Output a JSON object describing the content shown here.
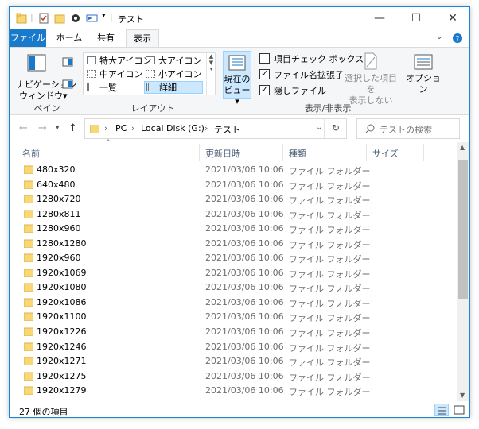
{
  "window": {
    "title": "テスト"
  },
  "tabs": [
    {
      "label": "ファイル"
    },
    {
      "label": "ホーム"
    },
    {
      "label": "共有"
    },
    {
      "label": "表示"
    }
  ],
  "ribbon": {
    "pane": {
      "nav_label": "ナビゲーション",
      "nav_label2": "ウィンドウ▾",
      "group_label": "ペイン"
    },
    "layout": {
      "items": [
        "特大アイコン",
        "大アイコン",
        "中アイコン",
        "小アイコン",
        "一覧",
        "詳細"
      ],
      "group_label": "レイアウト"
    },
    "current_view": {
      "label1": "現在の",
      "label2": "ビュー▾"
    },
    "show_hide": {
      "checkboxes": [
        {
          "label": "項目チェック ボックス",
          "checked": false
        },
        {
          "label": "ファイル名拡張子",
          "checked": true
        },
        {
          "label": "隠しファイル",
          "checked": true
        }
      ],
      "hide_selected1": "選択した項目を",
      "hide_selected2": "表示しない",
      "options_label": "オプション",
      "group_label": "表示/非表示"
    }
  },
  "address": {
    "path": [
      "PC",
      "Local Disk (G:)",
      "テスト"
    ],
    "search_placeholder": "テストの検索"
  },
  "columns": {
    "name": "名前",
    "date": "更新日時",
    "type": "種類",
    "size": "サイズ"
  },
  "files": [
    {
      "name": "480x320",
      "date": "2021/03/06 10:06",
      "type": "ファイル フォルダー"
    },
    {
      "name": "640x480",
      "date": "2021/03/06 10:06",
      "type": "ファイル フォルダー"
    },
    {
      "name": "1280x720",
      "date": "2021/03/06 10:06",
      "type": "ファイル フォルダー"
    },
    {
      "name": "1280x811",
      "date": "2021/03/06 10:06",
      "type": "ファイル フォルダー"
    },
    {
      "name": "1280x960",
      "date": "2021/03/06 10:06",
      "type": "ファイル フォルダー"
    },
    {
      "name": "1280x1280",
      "date": "2021/03/06 10:06",
      "type": "ファイル フォルダー"
    },
    {
      "name": "1920x960",
      "date": "2021/03/06 10:06",
      "type": "ファイル フォルダー"
    },
    {
      "name": "1920x1069",
      "date": "2021/03/06 10:06",
      "type": "ファイル フォルダー"
    },
    {
      "name": "1920x1080",
      "date": "2021/03/06 10:06",
      "type": "ファイル フォルダー"
    },
    {
      "name": "1920x1086",
      "date": "2021/03/06 10:06",
      "type": "ファイル フォルダー"
    },
    {
      "name": "1920x1100",
      "date": "2021/03/06 10:06",
      "type": "ファイル フォルダー"
    },
    {
      "name": "1920x1226",
      "date": "2021/03/06 10:06",
      "type": "ファイル フォルダー"
    },
    {
      "name": "1920x1246",
      "date": "2021/03/06 10:06",
      "type": "ファイル フォルダー"
    },
    {
      "name": "1920x1271",
      "date": "2021/03/06 10:06",
      "type": "ファイル フォルダー"
    },
    {
      "name": "1920x1275",
      "date": "2021/03/06 10:06",
      "type": "ファイル フォルダー"
    },
    {
      "name": "1920x1279",
      "date": "2021/03/06 10:06",
      "type": "ファイル フォルダー"
    }
  ],
  "status": {
    "item_count": "27 個の項目"
  },
  "colors": {
    "accent": "#1979ca",
    "folder": "#f8d775",
    "header_text": "#4c607a"
  }
}
